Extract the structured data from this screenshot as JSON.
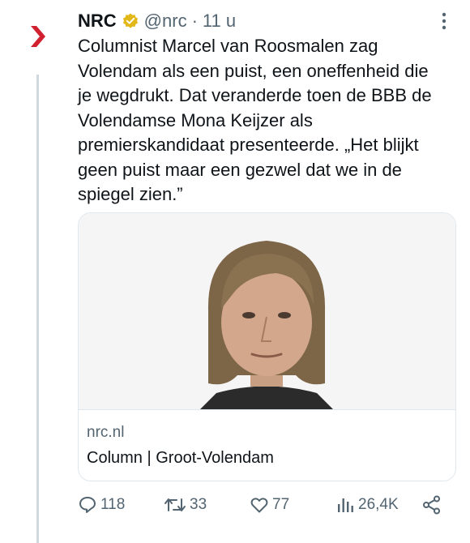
{
  "tweet": {
    "author_name": "NRC",
    "handle": "@nrc",
    "separator": "·",
    "time": "11 u",
    "text_lines": [
      "Columnist Marcel van Roosmalen zag",
      "Volendam als een puist, een oneffenheid die",
      "je wegdrukt. Dat veranderde toen de BBB de",
      "Volendamse Mona Keijzer als",
      "premierskandidaat presenteerde. „Het blijkt",
      "geen puist maar een gezwel dat we in de",
      "spiegel zien.”"
    ]
  },
  "card": {
    "domain": "nrc.nl",
    "title": "Column | Groot-Volendam"
  },
  "actions": {
    "replies": "118",
    "reposts": "33",
    "likes": "77",
    "views": "26,4K"
  },
  "colors": {
    "brand_red": "#d1202f",
    "verified_gold": "#e2b719",
    "text": "#0f1419",
    "muted": "#536471",
    "border": "#e1e8ed"
  },
  "icons": [
    "nrc-logo-icon",
    "verified-badge-icon",
    "more-icon",
    "reply-icon",
    "repost-icon",
    "like-icon",
    "views-icon",
    "share-icon"
  ]
}
